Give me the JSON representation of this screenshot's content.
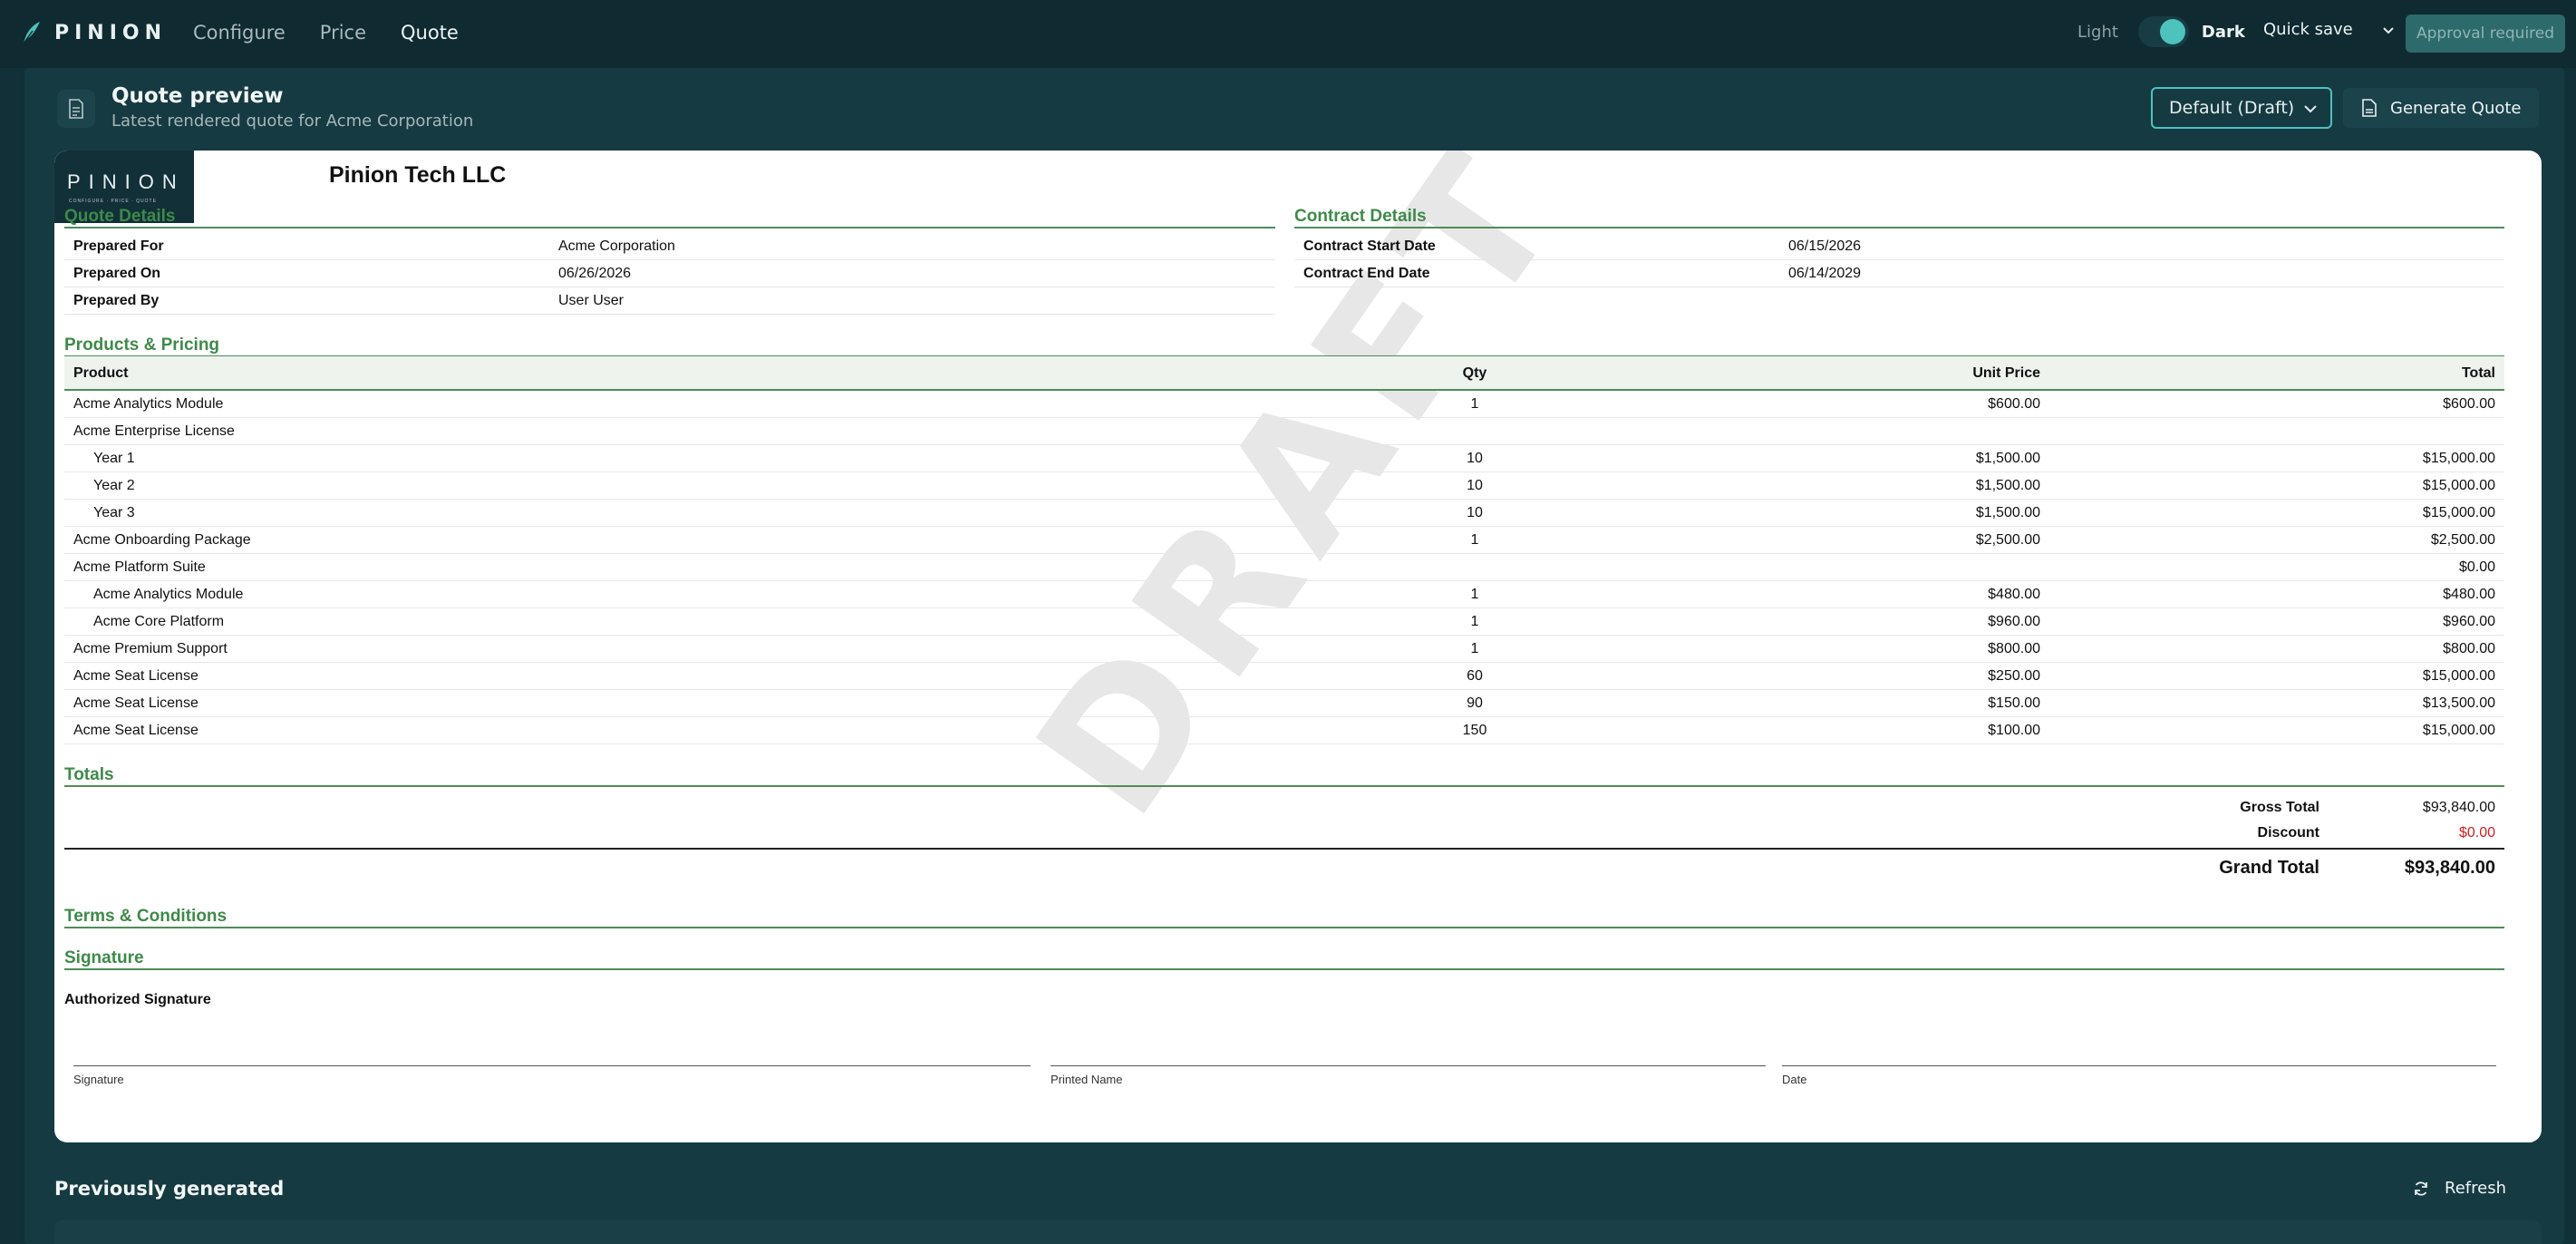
{
  "app": {
    "brand": "PINION"
  },
  "nav": {
    "items": [
      "Configure",
      "Price",
      "Quote"
    ],
    "active": "Quote"
  },
  "theme": {
    "light_label": "Light",
    "dark_label": "Dark"
  },
  "toolbar": {
    "quick_save": "Quick save",
    "approval": "Approval required"
  },
  "header": {
    "title": "Quote preview",
    "subtitle": "Latest rendered quote for Acme Corporation",
    "template_select": "Default (Draft)",
    "generate": "Generate Quote"
  },
  "doc": {
    "logo_text": "PINION",
    "logo_tagline": "CONFIGURE · PRICE · QUOTE",
    "company": "Pinion Tech LLC",
    "watermark": "DRAFT",
    "quote_details": {
      "title": "Quote Details",
      "rows": [
        {
          "k": "Prepared For",
          "v": "Acme Corporation"
        },
        {
          "k": "Prepared On",
          "v": "06/26/2026"
        },
        {
          "k": "Prepared By",
          "v": "User User"
        }
      ]
    },
    "contract_details": {
      "title": "Contract Details",
      "rows": [
        {
          "k": "Contract Start Date",
          "v": "06/15/2026"
        },
        {
          "k": "Contract End Date",
          "v": "06/14/2029"
        }
      ]
    },
    "products": {
      "title": "Products & Pricing",
      "headers": {
        "product": "Product",
        "qty": "Qty",
        "unit": "Unit Price",
        "total": "Total"
      },
      "rows": [
        {
          "product": "Acme Analytics Module",
          "qty": "1",
          "unit": "$600.00",
          "total": "$600.00",
          "sub": false
        },
        {
          "product": "Acme Enterprise License",
          "qty": "",
          "unit": "",
          "total": "",
          "sub": false
        },
        {
          "product": "Year 1",
          "qty": "10",
          "unit": "$1,500.00",
          "total": "$15,000.00",
          "sub": true
        },
        {
          "product": "Year 2",
          "qty": "10",
          "unit": "$1,500.00",
          "total": "$15,000.00",
          "sub": true
        },
        {
          "product": "Year 3",
          "qty": "10",
          "unit": "$1,500.00",
          "total": "$15,000.00",
          "sub": true
        },
        {
          "product": "Acme Onboarding Package",
          "qty": "1",
          "unit": "$2,500.00",
          "total": "$2,500.00",
          "sub": false
        },
        {
          "product": "Acme Platform Suite",
          "qty": "",
          "unit": "",
          "total": "$0.00",
          "sub": false
        },
        {
          "product": "Acme Analytics Module",
          "qty": "1",
          "unit": "$480.00",
          "total": "$480.00",
          "sub": true
        },
        {
          "product": "Acme Core Platform",
          "qty": "1",
          "unit": "$960.00",
          "total": "$960.00",
          "sub": true
        },
        {
          "product": "Acme Premium Support",
          "qty": "1",
          "unit": "$800.00",
          "total": "$800.00",
          "sub": false
        },
        {
          "product": "Acme Seat License",
          "qty": "60",
          "unit": "$250.00",
          "total": "$15,000.00",
          "sub": false
        },
        {
          "product": "Acme Seat License",
          "qty": "90",
          "unit": "$150.00",
          "total": "$13,500.00",
          "sub": false
        },
        {
          "product": "Acme Seat License",
          "qty": "150",
          "unit": "$100.00",
          "total": "$15,000.00",
          "sub": false
        }
      ]
    },
    "totals": {
      "title": "Totals",
      "gross_label": "Gross Total",
      "gross_value": "$93,840.00",
      "discount_label": "Discount",
      "discount_value": "$0.00",
      "grand_label": "Grand Total",
      "grand_value": "$93,840.00"
    },
    "terms": {
      "title": "Terms & Conditions"
    },
    "signature": {
      "title": "Signature",
      "authorized": "Authorized Signature",
      "sig_caption": "Signature",
      "name_caption": "Printed Name",
      "date_caption": "Date"
    }
  },
  "previous": {
    "title": "Previously generated",
    "refresh": "Refresh"
  },
  "colors": {
    "accent": "#4ec2bd",
    "section_green": "#3e8a49",
    "discount_red": "#d02020",
    "bg": "#123038"
  }
}
